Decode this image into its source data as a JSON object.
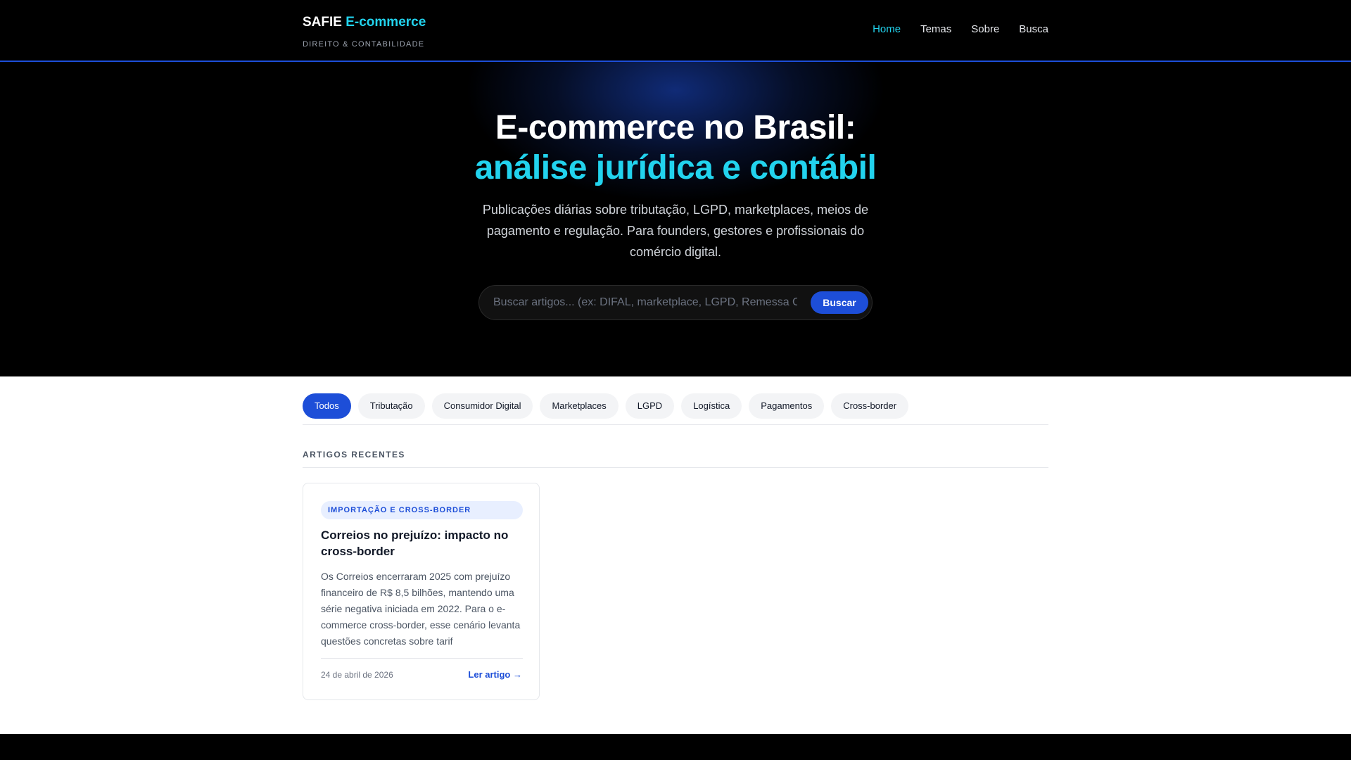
{
  "brand": {
    "name": "SAFIE",
    "accent": "E-commerce",
    "tagline": "DIREITO & CONTABILIDADE"
  },
  "nav": {
    "items": [
      {
        "label": "Home",
        "active": true
      },
      {
        "label": "Temas"
      },
      {
        "label": "Sobre"
      },
      {
        "label": "Busca"
      }
    ]
  },
  "hero": {
    "title_line1": "E-commerce no Brasil:",
    "title_line2": "análise jurídica e contábil",
    "description": "Publicações diárias sobre tributação, LGPD, marketplaces, meios de pagamento e regulação. Para founders, gestores e profissionais do comércio digital."
  },
  "search": {
    "placeholder": "Buscar artigos... (ex: DIFAL, marketplace, LGPD, Remessa Conforme)",
    "value": "",
    "button_label": "Buscar"
  },
  "filters": {
    "items": [
      {
        "label": "Todos",
        "active": true
      },
      {
        "label": "Tributação"
      },
      {
        "label": "Consumidor Digital"
      },
      {
        "label": "Marketplaces"
      },
      {
        "label": "LGPD"
      },
      {
        "label": "Logística"
      },
      {
        "label": "Pagamentos"
      },
      {
        "label": "Cross-border"
      }
    ]
  },
  "articles": {
    "heading": "ARTIGOS RECENTES",
    "items": [
      {
        "category": "IMPORTAÇÃO E CROSS-BORDER",
        "title": "Correios no prejuízo: impacto no cross-border",
        "excerpt": "Os Correios encerraram 2025 com prejuízo financeiro de R$ 8,5 bilhões, mantendo uma série negativa iniciada em 2022. Para o e-commerce cross-border, esse cenário levanta questões concretas sobre tarif",
        "date": "24 de abril de 2026",
        "link_label": "Ler artigo →"
      }
    ]
  },
  "colors": {
    "accent_cyan": "#22d3ee",
    "primary_blue": "#1d4ed8",
    "dark_bg": "#000000"
  }
}
